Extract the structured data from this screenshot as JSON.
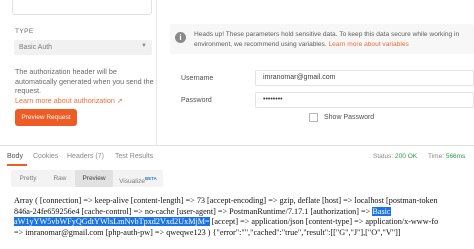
{
  "auth": {
    "type_label": "TYPE",
    "type_value": "Basic Auth",
    "help_lines": [
      "The authorization header will be",
      "automatically generated when you send the",
      "request."
    ],
    "help_link": "Learn more about authorization",
    "help_link_arrow": "↗",
    "preview_button": "Preview Request"
  },
  "notice": {
    "line1": "Heads up! These parameters hold sensitive data. To keep this data secure while working in",
    "line2_prefix": "environment, we recommend using variables.",
    "line2_link": "Learn more about variables"
  },
  "fields": {
    "username_label": "Username",
    "username_value": "imranomar@gmail.com",
    "password_label": "Password",
    "password_value": "••••••••",
    "show_password_label": "Show Password"
  },
  "response_tabs": {
    "items": [
      "Body",
      "Cookies",
      "Headers (7)",
      "Test Results"
    ],
    "active": "Body",
    "status_label": "Status:",
    "status_value": "200 OK",
    "time_label": "Time:",
    "time_value": "566ms"
  },
  "view_tabs": {
    "items": [
      "Pretty",
      "Raw",
      "Preview",
      "Visualize"
    ],
    "beta": "BETA",
    "active": "Preview"
  },
  "body_output": {
    "line1": "Array ( [connection] => keep-alive [content-length] => 73 [accept-encoding] => gzip, deflate [host] => localhost [postman-token",
    "line2": "846a-24fe659256e4 [cache-control] => no-cache [user-agent] => PostmanRuntime/7.17.1 [authorization] => ",
    "line2_selected": "Basic",
    "line3_selected": "aW1yYW5vbWFyQGdtYWlsLmNvbTpxd2Vxd2UxMjM=",
    "line3_rest": " [accept] => application/json [content-type] => application/x-www-fo",
    "line4": "=> imranomar@gmail.com [php-auth-pw] => qweqwe123 ) {\"error\":\"\",\"cached\":\"true\",\"result\":[[\"G\",\"J\"],[\"O\",\"V\"]]"
  },
  "colors": {
    "accent": "#ef5b25",
    "link": "#f26b3a",
    "status_ok": "#2a9c46",
    "selection": "#1a73e8"
  }
}
